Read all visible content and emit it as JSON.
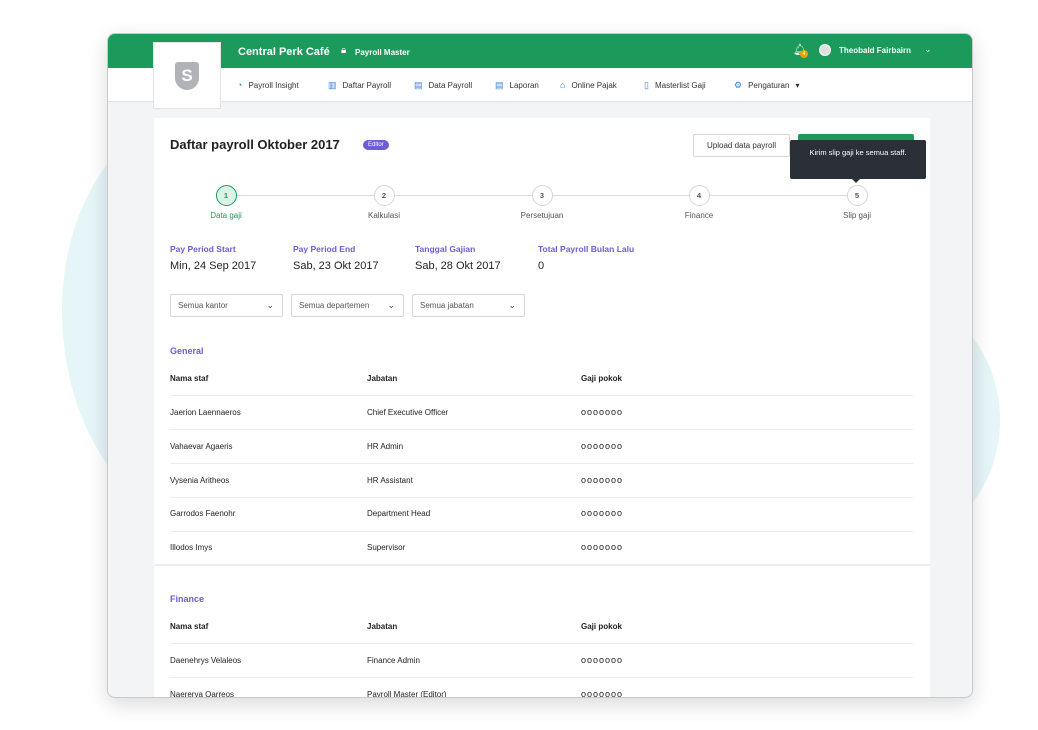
{
  "app": {
    "company": "Central Perk Café",
    "role": "Payroll Master",
    "notification_count": "4",
    "user_name": "Theobald Fairbairn",
    "logo_letter": "S"
  },
  "nav": [
    {
      "label": "Payroll Insight",
      "icon": "gauge-icon"
    },
    {
      "label": "Daftar Payroll",
      "icon": "building-icon"
    },
    {
      "label": "Data Payroll",
      "icon": "document-icon"
    },
    {
      "label": "Laporan",
      "icon": "report-icon"
    },
    {
      "label": "Online Pajak",
      "icon": "bank-icon"
    },
    {
      "label": "Masterlist Gaji",
      "icon": "file-icon"
    },
    {
      "label": "Pengaturan",
      "icon": "gear-icon"
    }
  ],
  "page": {
    "title": "Daftar payroll Oktober 2017",
    "badge": "Editor",
    "upload_button": "Upload data payroll",
    "tooltip": "Kirim slip gaji ke semua staff."
  },
  "steps": [
    {
      "number": "1",
      "label": "Data gaji",
      "active": true
    },
    {
      "number": "2",
      "label": "Kalkulasi",
      "active": false
    },
    {
      "number": "3",
      "label": "Persetujuan",
      "active": false
    },
    {
      "number": "4",
      "label": "Finance",
      "active": false
    },
    {
      "number": "5",
      "label": "Slip gaji",
      "active": false
    }
  ],
  "info": [
    {
      "label": "Pay Period Start",
      "value": "Min, 24 Sep 2017"
    },
    {
      "label": "Pay Period End",
      "value": "Sab, 23 Okt 2017"
    },
    {
      "label": "Tanggal Gajian",
      "value": "Sab, 28 Okt 2017"
    },
    {
      "label": "Total Payroll Bulan Lalu",
      "value": "0"
    }
  ],
  "filters": [
    {
      "value": "Semua kantor"
    },
    {
      "value": "Semua departemen"
    },
    {
      "value": "Semua jabatan"
    }
  ],
  "table_headers": {
    "name": "Nama staf",
    "position": "Jabatan",
    "salary": "Gaji pokok"
  },
  "salary_mask": "οοοοοοο",
  "sections": [
    {
      "title": "General",
      "rows": [
        {
          "name": "Jaerion Laennaeros",
          "position": "Chief Executive Officer"
        },
        {
          "name": "Vahaevar Agaeris",
          "position": "HR Admin"
        },
        {
          "name": "Vysenia Aritheos",
          "position": "HR Assistant"
        },
        {
          "name": "Garrodos Faenohr",
          "position": "Department Head"
        },
        {
          "name": "Illodos Imys",
          "position": "Supervisor"
        }
      ]
    },
    {
      "title": "Finance",
      "rows": [
        {
          "name": "Daenehrys Velaleos",
          "position": "Finance Admin"
        },
        {
          "name": "Naererya Qarreos",
          "position": "Payroll Master (Editor)"
        }
      ]
    }
  ]
}
